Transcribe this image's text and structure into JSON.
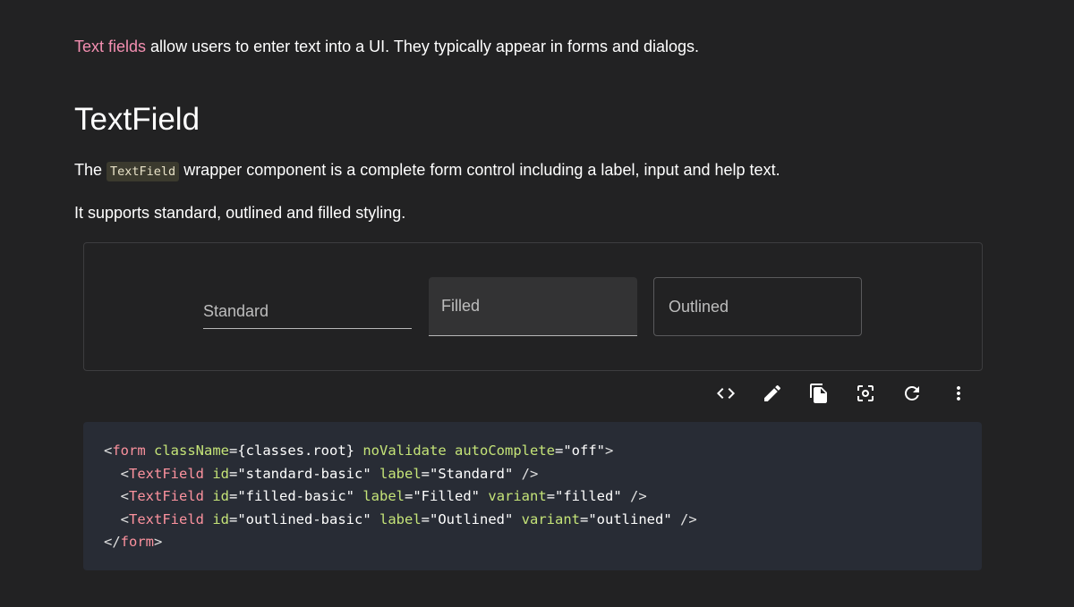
{
  "intro": {
    "link": "Text fields",
    "rest": " allow users to enter text into a UI. They typically appear in forms and dialogs."
  },
  "heading": "TextField",
  "paragraph1": {
    "before": "The ",
    "code": "TextField",
    "after": " wrapper component is a complete form control including a label, input and help text."
  },
  "paragraph2": "It supports standard, outlined and filled styling.",
  "demo": {
    "standard_label": "Standard",
    "filled_label": "Filled",
    "outlined_label": "Outlined"
  },
  "toolbar": {
    "icons": [
      "code-icon",
      "edit-icon",
      "copy-icon",
      "screenshot-icon",
      "reset-icon",
      "more-vert-icon"
    ]
  },
  "code": {
    "line1": {
      "open": "<",
      "tag": "form",
      "a1": "className",
      "v1": "={classes.root}",
      "a2": "noValidate",
      "a3": "autoComplete",
      "v3": "=\"off\"",
      "close": ">"
    },
    "line2": {
      "indent": "  <",
      "tag": "TextField",
      "a1": "id",
      "v1": "=\"standard-basic\"",
      "a2": "label",
      "v2": "=\"Standard\"",
      "close": " />"
    },
    "line3": {
      "indent": "  <",
      "tag": "TextField",
      "a1": "id",
      "v1": "=\"filled-basic\"",
      "a2": "label",
      "v2": "=\"Filled\"",
      "a3": "variant",
      "v3": "=\"filled\"",
      "close": " />"
    },
    "line4": {
      "indent": "  <",
      "tag": "TextField",
      "a1": "id",
      "v1": "=\"outlined-basic\"",
      "a2": "label",
      "v2": "=\"Outlined\"",
      "a3": "variant",
      "v3": "=\"outlined\"",
      "close": " />"
    },
    "line5": {
      "open": "</",
      "tag": "form",
      "close": ">"
    }
  },
  "colors": {
    "background": "#222223",
    "link": "#f48fb1",
    "code_bg": "#282c35",
    "code_tag": "#fc929e",
    "code_attr": "#c5e478"
  }
}
